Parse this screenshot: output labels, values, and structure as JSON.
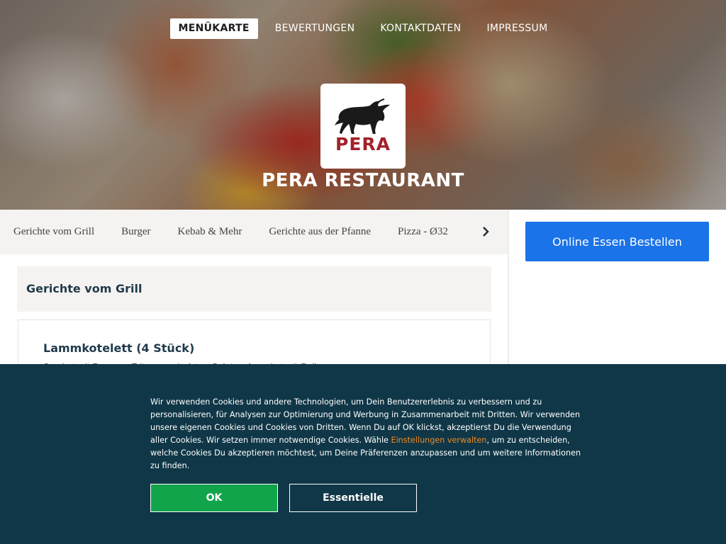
{
  "nav": {
    "items": [
      {
        "label": "MENÜKARTE",
        "active": true
      },
      {
        "label": "BEWERTUNGEN",
        "active": false
      },
      {
        "label": "KONTAKTDATEN",
        "active": false
      },
      {
        "label": "IMPRESSUM",
        "active": false
      }
    ]
  },
  "brand": {
    "logo_text": "PERA",
    "logo_icon": "bull-icon",
    "name": "PERA RESTAURANT",
    "logo_color": "#a3212a"
  },
  "categories": {
    "items": [
      "Gerichte vom Grill",
      "Burger",
      "Kebab & Mehr",
      "Gerichte aus der Pfanne",
      "Pizza - Ø32"
    ],
    "next_icon": "chevron-right-icon"
  },
  "order": {
    "button_label": "Online Essen Bestellen",
    "accent": "#1a73e8"
  },
  "menu": {
    "section_title": "Gerichte vom Grill",
    "dishes": [
      {
        "name": "Lammkotelett (4 Stück)",
        "description": "Serviert mit Pommes Frites, gemischtem Salat und serviert mit Beilagen"
      }
    ]
  },
  "cookie": {
    "text_before_link": "Wir verwenden Cookies und andere Technologien, um Dein Benutzererlebnis zu verbessern und zu personalisieren, für Analysen zur Optimierung und Werbung in Zusammenarbeit mit Dritten. Wir verwenden unsere eigenen Cookies und Cookies von Dritten. Wenn Du auf OK klickst, akzeptierst Du die Verwendung aller Cookies. Wir setzen immer notwendige Cookies. Wähle ",
    "link_text": "Einstellungen verwalten",
    "text_after_link": ", um zu entscheiden, welche Cookies Du akzeptieren möchtest, um Deine Präferenzen anzupassen und um weitere Informationen zu finden.",
    "ok_label": "OK",
    "essential_label": "Essentielle",
    "background": "#103747",
    "ok_color": "#11a44b",
    "link_color": "#f08a24"
  }
}
